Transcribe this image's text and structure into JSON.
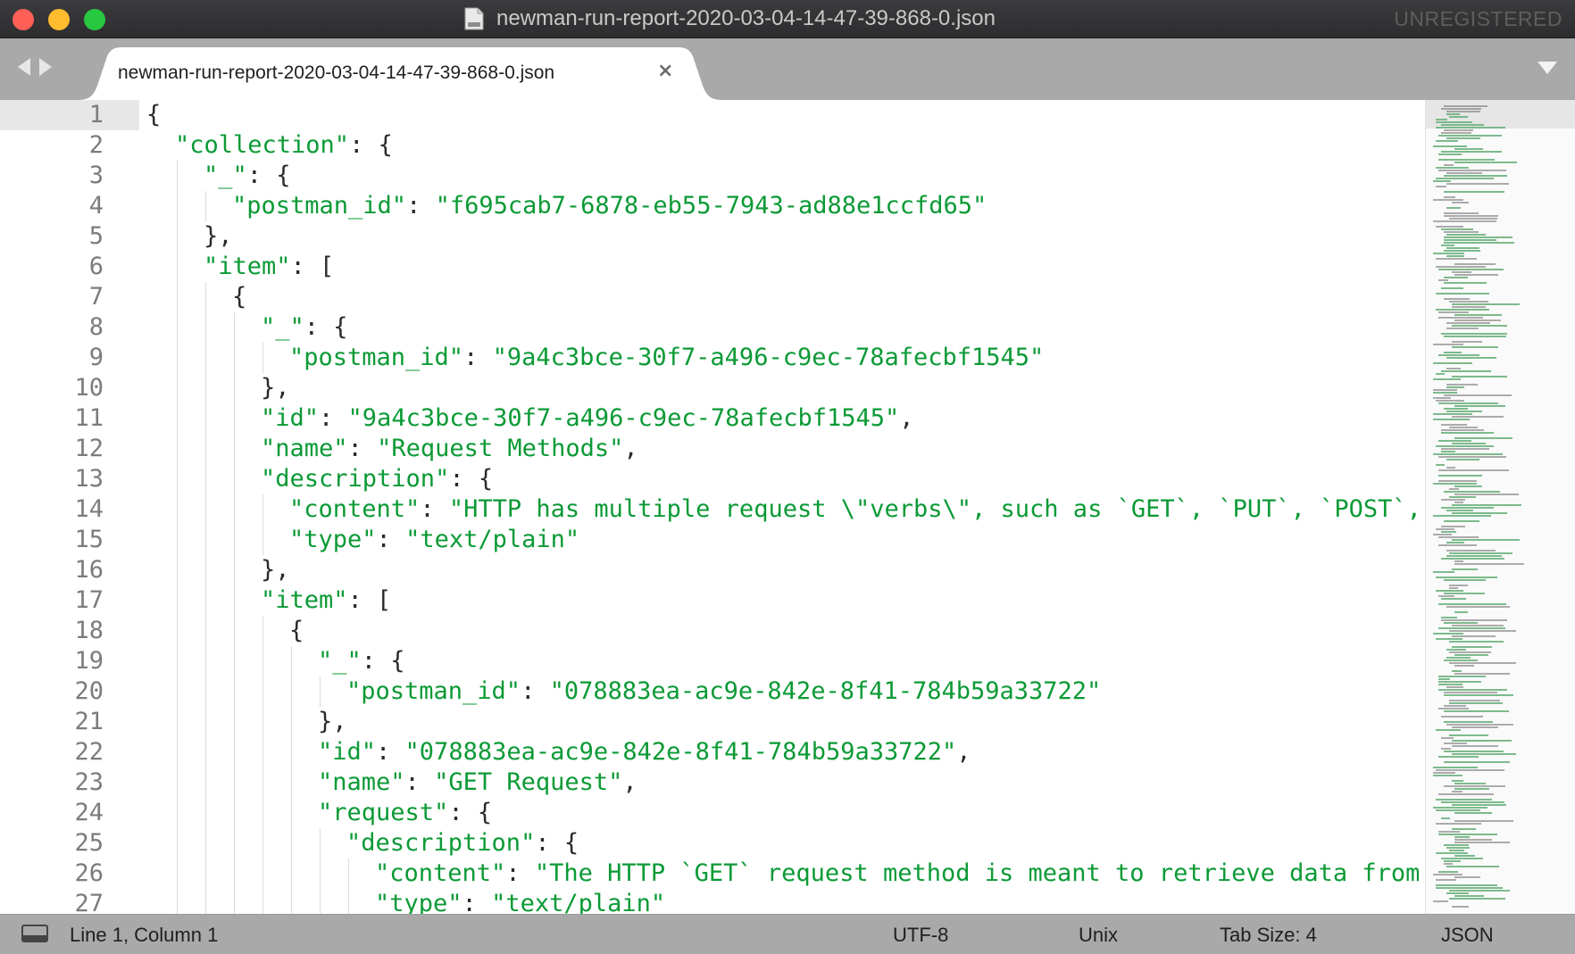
{
  "window": {
    "title": "newman-run-report-2020-03-04-14-47-39-868-0.json",
    "unregistered": "UNREGISTERED"
  },
  "tab": {
    "label": "newman-run-report-2020-03-04-14-47-39-868-0.json",
    "close": "×"
  },
  "editor": {
    "lines": [
      {
        "n": "1",
        "indent": 0,
        "segs": [
          {
            "t": "{",
            "c": "p"
          }
        ]
      },
      {
        "n": "2",
        "indent": 1,
        "segs": [
          {
            "t": "\"collection\"",
            "c": "k"
          },
          {
            "t": ": {",
            "c": "p"
          }
        ]
      },
      {
        "n": "3",
        "indent": 2,
        "segs": [
          {
            "t": "\"_\"",
            "c": "k"
          },
          {
            "t": ": {",
            "c": "p"
          }
        ]
      },
      {
        "n": "4",
        "indent": 3,
        "segs": [
          {
            "t": "\"postman_id\"",
            "c": "k"
          },
          {
            "t": ": ",
            "c": "p"
          },
          {
            "t": "\"f695cab7-6878-eb55-7943-ad88e1ccfd65\"",
            "c": "s"
          }
        ]
      },
      {
        "n": "5",
        "indent": 2,
        "segs": [
          {
            "t": "},",
            "c": "p"
          }
        ]
      },
      {
        "n": "6",
        "indent": 2,
        "segs": [
          {
            "t": "\"item\"",
            "c": "k"
          },
          {
            "t": ": [",
            "c": "p"
          }
        ]
      },
      {
        "n": "7",
        "indent": 3,
        "segs": [
          {
            "t": "{",
            "c": "p"
          }
        ]
      },
      {
        "n": "8",
        "indent": 4,
        "segs": [
          {
            "t": "\"_\"",
            "c": "k"
          },
          {
            "t": ": {",
            "c": "p"
          }
        ]
      },
      {
        "n": "9",
        "indent": 5,
        "segs": [
          {
            "t": "\"postman_id\"",
            "c": "k"
          },
          {
            "t": ": ",
            "c": "p"
          },
          {
            "t": "\"9a4c3bce-30f7-a496-c9ec-78afecbf1545\"",
            "c": "s"
          }
        ]
      },
      {
        "n": "10",
        "indent": 4,
        "segs": [
          {
            "t": "},",
            "c": "p"
          }
        ]
      },
      {
        "n": "11",
        "indent": 4,
        "segs": [
          {
            "t": "\"id\"",
            "c": "k"
          },
          {
            "t": ": ",
            "c": "p"
          },
          {
            "t": "\"9a4c3bce-30f7-a496-c9ec-78afecbf1545\"",
            "c": "s"
          },
          {
            "t": ",",
            "c": "p"
          }
        ]
      },
      {
        "n": "12",
        "indent": 4,
        "segs": [
          {
            "t": "\"name\"",
            "c": "k"
          },
          {
            "t": ": ",
            "c": "p"
          },
          {
            "t": "\"Request Methods\"",
            "c": "s"
          },
          {
            "t": ",",
            "c": "p"
          }
        ]
      },
      {
        "n": "13",
        "indent": 4,
        "segs": [
          {
            "t": "\"description\"",
            "c": "k"
          },
          {
            "t": ": {",
            "c": "p"
          }
        ]
      },
      {
        "n": "14",
        "indent": 5,
        "segs": [
          {
            "t": "\"content\"",
            "c": "k"
          },
          {
            "t": ": ",
            "c": "p"
          },
          {
            "t": "\"HTTP has multiple request \\\"verbs\\\", such as `GET`, `PUT`, `POST`, `",
            "c": "s"
          }
        ]
      },
      {
        "n": "15",
        "indent": 5,
        "segs": [
          {
            "t": "\"type\"",
            "c": "k"
          },
          {
            "t": ": ",
            "c": "p"
          },
          {
            "t": "\"text/plain\"",
            "c": "s"
          }
        ]
      },
      {
        "n": "16",
        "indent": 4,
        "segs": [
          {
            "t": "},",
            "c": "p"
          }
        ]
      },
      {
        "n": "17",
        "indent": 4,
        "segs": [
          {
            "t": "\"item\"",
            "c": "k"
          },
          {
            "t": ": [",
            "c": "p"
          }
        ]
      },
      {
        "n": "18",
        "indent": 5,
        "segs": [
          {
            "t": "{",
            "c": "p"
          }
        ]
      },
      {
        "n": "19",
        "indent": 6,
        "segs": [
          {
            "t": "\"_\"",
            "c": "k"
          },
          {
            "t": ": {",
            "c": "p"
          }
        ]
      },
      {
        "n": "20",
        "indent": 7,
        "segs": [
          {
            "t": "\"postman_id\"",
            "c": "k"
          },
          {
            "t": ": ",
            "c": "p"
          },
          {
            "t": "\"078883ea-ac9e-842e-8f41-784b59a33722\"",
            "c": "s"
          }
        ]
      },
      {
        "n": "21",
        "indent": 6,
        "segs": [
          {
            "t": "},",
            "c": "p"
          }
        ]
      },
      {
        "n": "22",
        "indent": 6,
        "segs": [
          {
            "t": "\"id\"",
            "c": "k"
          },
          {
            "t": ": ",
            "c": "p"
          },
          {
            "t": "\"078883ea-ac9e-842e-8f41-784b59a33722\"",
            "c": "s"
          },
          {
            "t": ",",
            "c": "p"
          }
        ]
      },
      {
        "n": "23",
        "indent": 6,
        "segs": [
          {
            "t": "\"name\"",
            "c": "k"
          },
          {
            "t": ": ",
            "c": "p"
          },
          {
            "t": "\"GET Request\"",
            "c": "s"
          },
          {
            "t": ",",
            "c": "p"
          }
        ]
      },
      {
        "n": "24",
        "indent": 6,
        "segs": [
          {
            "t": "\"request\"",
            "c": "k"
          },
          {
            "t": ": {",
            "c": "p"
          }
        ]
      },
      {
        "n": "25",
        "indent": 7,
        "segs": [
          {
            "t": "\"description\"",
            "c": "k"
          },
          {
            "t": ": {",
            "c": "p"
          }
        ]
      },
      {
        "n": "26",
        "indent": 8,
        "segs": [
          {
            "t": "\"content\"",
            "c": "k"
          },
          {
            "t": ": ",
            "c": "p"
          },
          {
            "t": "\"The HTTP `GET` request method is meant to retrieve data from a",
            "c": "s"
          }
        ]
      },
      {
        "n": "27",
        "indent": 8,
        "segs": [
          {
            "t": "\"type\"",
            "c": "k"
          },
          {
            "t": ": ",
            "c": "p"
          },
          {
            "t": "\"text/plain\"",
            "c": "s"
          }
        ]
      }
    ]
  },
  "status": {
    "position": "Line 1, Column 1",
    "encoding": "UTF-8",
    "line_endings": "Unix",
    "tab_size": "Tab Size: 4",
    "syntax": "JSON"
  },
  "colors": {
    "key": "#0b9a35",
    "string": "#0b9a35",
    "punctuation": "#2a2a2a",
    "line_number": "#7c7c7c"
  },
  "icons": {
    "title_doc": "document-icon",
    "nav": [
      "back-arrow-icon",
      "forward-arrow-icon"
    ],
    "tab_close": "close-icon",
    "tab_menu": "chevron-down-icon",
    "status_panel": "panel-toggle-icon"
  }
}
